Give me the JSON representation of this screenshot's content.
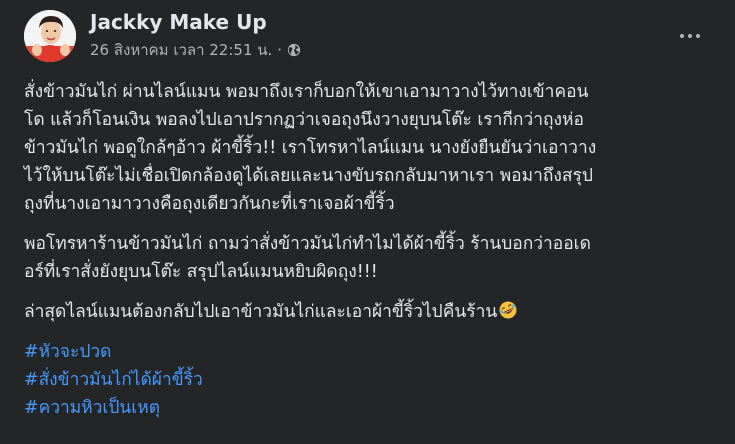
{
  "post": {
    "author": "Jackky Make Up",
    "timestamp": "26 สิงหาคม เวลา 22:51 น.",
    "separator": "·",
    "privacy_icon": "globe-icon",
    "more_icon": "more-options-icon",
    "paragraphs": [
      [
        "สั่งข้าวมันไก่ ผ่านไลน์แมน พอมาถึงเราก็บอกให้เขาเอามาวางไว้ทางเข้าคอน",
        "โด แล้วก็โอนเงิน พอลงไปเอาปรากฏว่าเจอถุงนึงวางยุบนโต๊ะ เรากีกว่าถุงห่อ",
        "ข้าวมันไก่ พอดูใกล้ๆอ้าว ผ้าขี้ริ้ว!! เราโทรหาไลน์แมน นางยังยืนยันว่าเอาวาง",
        "ไว้ให้บนโต๊ะไม่เชื่อเปิดกล้องดูได้เลยและนางขับรถกลับมาหาเรา พอมาถึงสรุป",
        "ถุงที่นางเอามาวางคือถุงเดียวกันกะที่เราเจอผ้าขี้ริ้ว"
      ],
      [
        "พอโทรหาร้านข้าวมันไก่ ถามว่าสั่งข้าวมันไก่ทำไมได้ผ้าขี้ริ้ว ร้านบอกว่าออเด",
        "อร์ที่เราสั่งยังยุบนโต๊ะ สรุปไลน์แมนหยิบผิดถุง!!!"
      ],
      [
        "ล่าสุดไลน์แมนต้องกลับไปเอาข้าวมันไก่และเอาผ้าขี้ริ้วไปคืนร้าน"
      ]
    ],
    "last_emoji": "rolling-laughing-emoji",
    "hashtags": [
      "#หัวจะปวด",
      "#สั่งข้าวมันไก่ได้ผ้าขี้ริ้ว",
      "#ความหิวเป็นเหตุ"
    ]
  },
  "colors": {
    "background": "#242526",
    "text": "#e4e6eb",
    "secondary": "#b0b3b8",
    "link": "#4599ff"
  }
}
